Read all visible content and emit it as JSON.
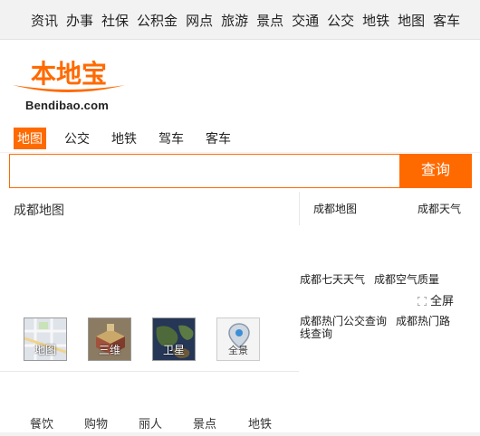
{
  "top_nav": [
    "资讯",
    "办事",
    "社保",
    "公积金",
    "网点",
    "旅游",
    "景点",
    "交通",
    "公交",
    "地铁",
    "地图",
    "客车"
  ],
  "logo": {
    "chinese": "本地宝",
    "domain": "Bendibao.com",
    "brand_color": "#ff6a00"
  },
  "tabs": [
    {
      "label": "地图",
      "active": true
    },
    {
      "label": "公交",
      "active": false
    },
    {
      "label": "地铁",
      "active": false
    },
    {
      "label": "驾车",
      "active": false
    },
    {
      "label": "客车",
      "active": false
    }
  ],
  "search": {
    "value": "",
    "placeholder": "",
    "button_label": "查询"
  },
  "city_title": "成都地图",
  "map_types": [
    {
      "label": "地图",
      "icon": "map-thumbnail-icon"
    },
    {
      "label": "三维",
      "icon": "3d-thumbnail-icon"
    },
    {
      "label": "卫星",
      "icon": "satellite-thumbnail-icon"
    },
    {
      "label": "全景",
      "icon": "panorama-pin-icon"
    }
  ],
  "poi_categories": [
    "餐饮",
    "购物",
    "丽人",
    "景点",
    "地铁"
  ],
  "right_links": {
    "map": "成都地图",
    "weather": "成都天气",
    "seven_day": "成都七天天气",
    "air_quality": "成都空气质量",
    "fullscreen": "全屏",
    "bus_query": "成都热门公交查询",
    "route_query": "成都热门路线查询"
  },
  "colors": {
    "accent": "#ff6a00",
    "top_nav_bg": "#f2f2f2",
    "text": "#333333"
  }
}
